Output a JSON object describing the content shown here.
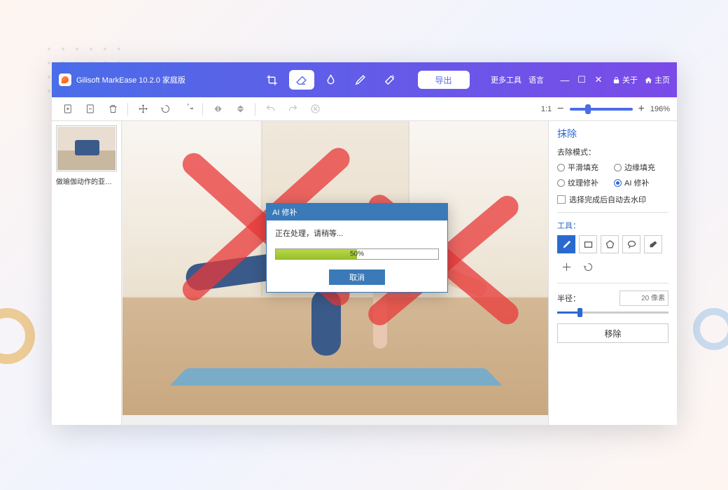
{
  "titlebar": {
    "title": "Gilisoft MarkEase 10.2.0 家庭版",
    "export": "导出",
    "more_tools": "更多工具",
    "language": "语言",
    "about": "关于",
    "home": "主页"
  },
  "toolbar2": {
    "zoom_ratio": "1:1",
    "zoom_pct": "196%"
  },
  "thumbnail": {
    "caption": "做瑜伽动作的亚洲..."
  },
  "side": {
    "title": "抹除",
    "mode_label": "去除模式：",
    "modes": {
      "smooth": "平滑填充",
      "edge": "边缘填充",
      "texture": "纹理修补",
      "ai": "AI 修补"
    },
    "selected_mode": "ai",
    "auto_remove": "选择完成后自动去水印",
    "tools_label": "工具：",
    "radius_label": "半径：",
    "radius_value": "20 像素",
    "remove_btn": "移除"
  },
  "dialog": {
    "title": "AI 修补",
    "message": "正在处理，请稍等...",
    "progress": 50,
    "progress_text": "50%",
    "cancel": "取消"
  }
}
